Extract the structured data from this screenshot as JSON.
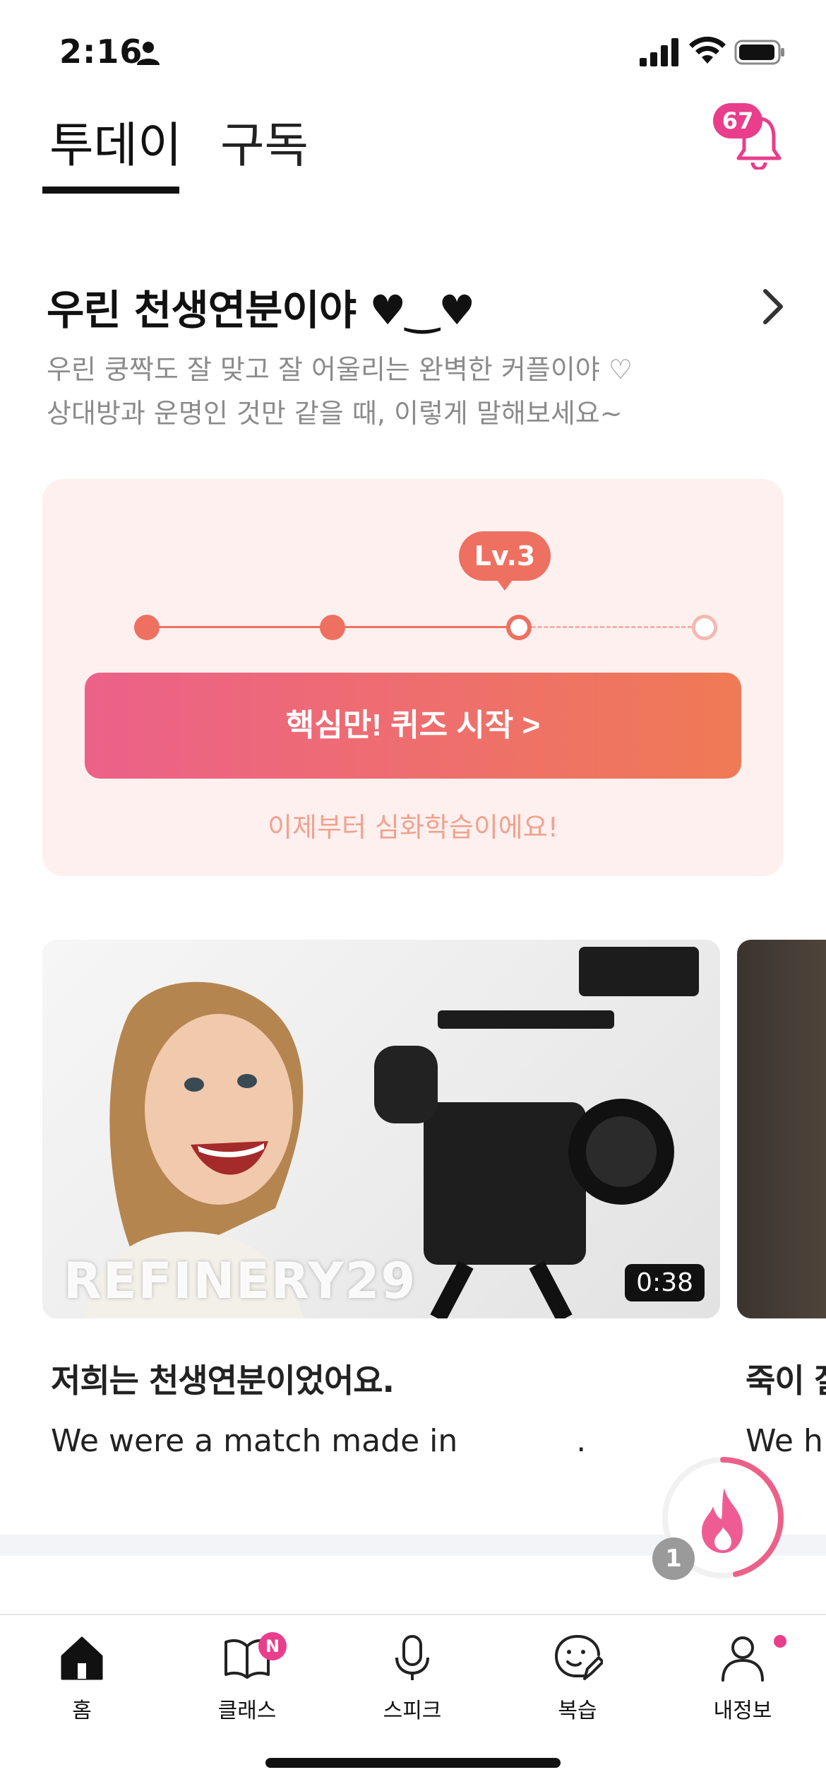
{
  "status_bar": {
    "time": "2:16",
    "icons": [
      "person-icon",
      "signal-icon",
      "wifi-icon",
      "battery-icon"
    ]
  },
  "top_tabs": {
    "items": [
      {
        "label": "투데이",
        "active": true
      },
      {
        "label": "구독",
        "active": false
      }
    ],
    "notification_count": "67"
  },
  "section": {
    "title": "우린 천생연분이야 ♥‿♥",
    "description_line1": "우린 쿵짝도 잘 맞고 잘 어울리는 완벽한 커플이야 ♡",
    "description_line2": "상대방과 운명인 것만 같을 때, 이렇게 말해보세요~"
  },
  "level_card": {
    "level_label": "Lv.3",
    "current_level": 3,
    "total_levels": 4,
    "quiz_button": "핵심만! 퀴즈 시작 >",
    "subtext": "이제부터 심화학습이에요!"
  },
  "videos": [
    {
      "brand": "REFINERY29",
      "duration": "0:38",
      "title": "저희는 천생연분이었어요.",
      "sentence": "We were a match made in _______."
    },
    {
      "title": "죽이 잘",
      "sentence": "We hi"
    }
  ],
  "streak": {
    "count": "1",
    "icon": "flame-icon"
  },
  "bottom_nav": {
    "items": [
      {
        "label": "홈",
        "icon": "home-icon",
        "active": true
      },
      {
        "label": "클래스",
        "icon": "book-icon",
        "badge": "N"
      },
      {
        "label": "스피크",
        "icon": "microphone-icon"
      },
      {
        "label": "복습",
        "icon": "review-icon"
      },
      {
        "label": "내정보",
        "icon": "profile-icon",
        "dot": true
      }
    ]
  },
  "colors": {
    "accent_pink": "#e83e8c",
    "level_coral": "#ee7060",
    "card_bg": "#fdf0ee",
    "text_gray": "#8b8b8b"
  }
}
